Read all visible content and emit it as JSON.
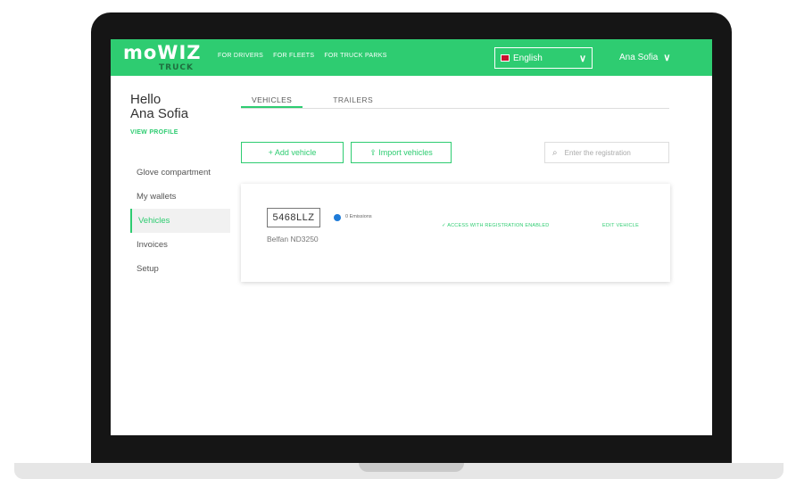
{
  "brand": {
    "name": "moWIZ",
    "sub": "TRUCK"
  },
  "nav": {
    "links": [
      "FOR DRIVERS",
      "FOR FLEETS",
      "FOR TRUCK PARKS"
    ],
    "language": "English",
    "user": "Ana Sofia"
  },
  "sidebar": {
    "greeting_line1": "Hello",
    "greeting_line2": "Ana Sofia",
    "view_profile": "VIEW PROFILE",
    "items": [
      {
        "label": "Glove compartment",
        "active": false
      },
      {
        "label": "My wallets",
        "active": false
      },
      {
        "label": "Vehicles",
        "active": true
      },
      {
        "label": "Invoices",
        "active": false
      },
      {
        "label": "Setup",
        "active": false
      }
    ]
  },
  "tabs": [
    {
      "label": "VEHICLES",
      "active": true
    },
    {
      "label": "TRAILERS",
      "active": false
    }
  ],
  "actions": {
    "add_vehicle": "+ Add vehicle",
    "import_vehicles": "⇪ Import vehicles",
    "search_placeholder": "Enter the registration"
  },
  "vehicle": {
    "plate": "5468LLZ",
    "model": "Belfan ND3250",
    "emissions": "0 Emissions",
    "access_status": "ACCESS WITH REGISTRATION ENABLED",
    "edit_label": "EDIT VEHICLE"
  },
  "colors": {
    "accent": "#2ecc71",
    "emission_dot": "#1e7bd8"
  }
}
